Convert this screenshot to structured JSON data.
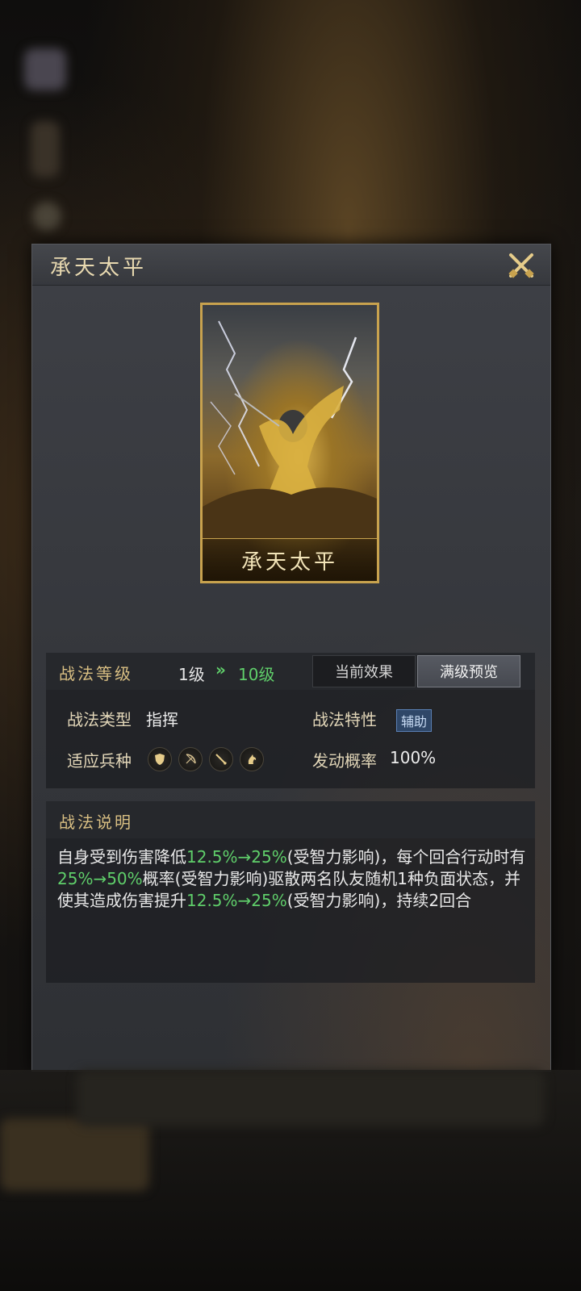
{
  "dialog": {
    "title": "承天太平",
    "close_icon": "close-crossed-swords-icon"
  },
  "card": {
    "name": "承天太平",
    "art": "sorcerer-summoning-lightning"
  },
  "level": {
    "label": "战法等级",
    "from": "1级",
    "arrow": "»",
    "to": "10级"
  },
  "tabs": {
    "current_label": "当前效果",
    "max_label": "满级预览",
    "selected": "满级预览"
  },
  "attributes": {
    "type_label": "战法类型",
    "type_value": "指挥",
    "trait_label": "战法特性",
    "trait_value": "辅助",
    "troops_label": "适应兵种",
    "troop_icons": [
      "shield-icon",
      "bow-icon",
      "spear-icon",
      "horse-icon"
    ],
    "rate_label": "发动概率",
    "rate_value": "100%"
  },
  "description": {
    "title": "战法说明",
    "p1": "自身受到伤害降低",
    "h1": "12.5%→25%",
    "p2": "(受智力影响)，每个回合行动时有",
    "h2": "25%→50%",
    "p3": "概率(受智力影响)驱散两名队友随机1种负面状态，并使其造成伤害提升",
    "h3": "12.5%→25%",
    "p4": "(受智力影响)，持续2回合"
  },
  "colors": {
    "gold": "#d9bf83",
    "highlight_green": "#5fce6a",
    "card_border": "#c8a24e"
  }
}
